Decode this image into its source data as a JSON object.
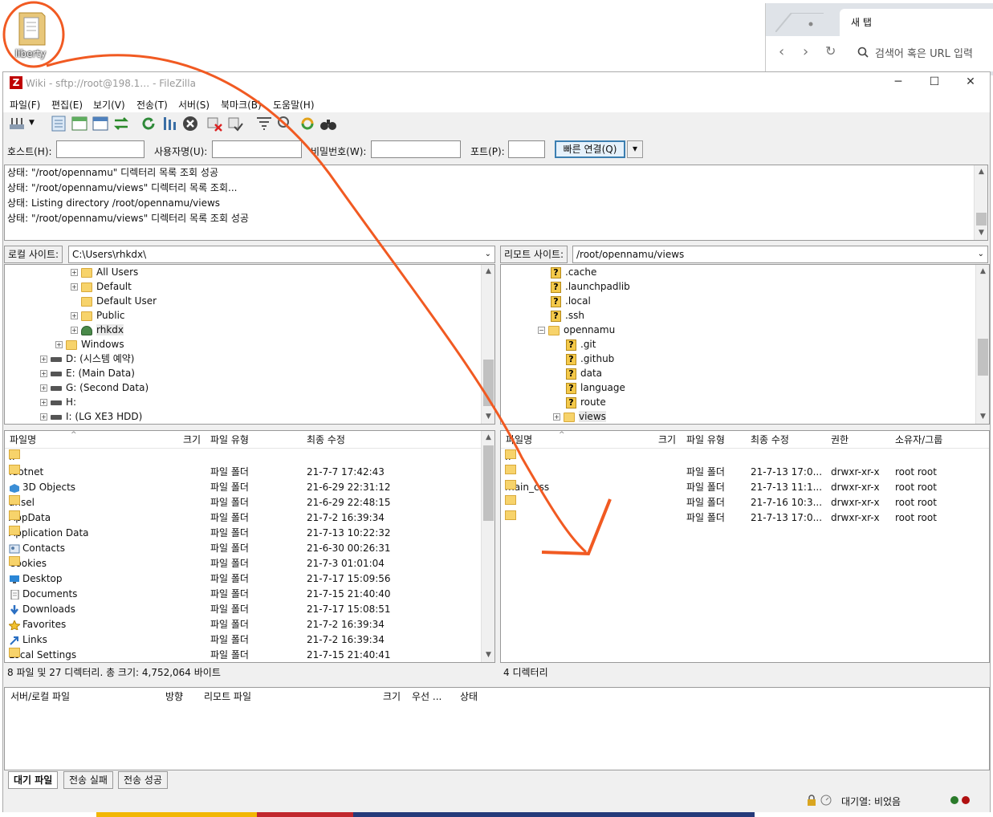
{
  "desktop": {
    "icon_label": "liberty"
  },
  "browser": {
    "tab_title": "새 탭",
    "url_placeholder": "검색어 혹은 URL 입력"
  },
  "window": {
    "title": "Wiki - sftp://root@198.1…          - FileZilla",
    "logo": "Z"
  },
  "menu": [
    "파일(F)",
    "편집(E)",
    "보기(V)",
    "전송(T)",
    "서버(S)",
    "북마크(B)",
    "도움말(H)"
  ],
  "quickconnect": {
    "host_label": "호스트(H):",
    "user_label": "사용자명(U):",
    "pass_label": "비밀번호(W):",
    "port_label": "포트(P):",
    "host_value": "",
    "user_value": "",
    "pass_value": "",
    "port_value": "",
    "connect_label": "빠른 연결(Q)",
    "dropdown": "▾"
  },
  "log": [
    "상태:  \"/root/opennamu\" 디렉터리 목록 조회 성공",
    "상태:  \"/root/opennamu/views\" 디렉터리 목록 조회...",
    "상태:  Listing directory /root/opennamu/views",
    "상태:  \"/root/opennamu/views\" 디렉터리 목록 조회 성공"
  ],
  "local": {
    "site_label": "로컬 사이트:",
    "path": "C:\\Users\\rhkdx\\",
    "tree": [
      {
        "label": "All Users"
      },
      {
        "label": "Default"
      },
      {
        "label": "Default User"
      },
      {
        "label": "Public"
      },
      {
        "label": "rhkdx"
      },
      {
        "label": "Windows"
      },
      {
        "label": "D: (시스템 예약)"
      },
      {
        "label": "E: (Main Data)"
      },
      {
        "label": "G: (Second Data)"
      },
      {
        "label": "H:"
      },
      {
        "label": "I: (LG XE3 HDD)"
      }
    ],
    "headers": {
      "name": "파일명",
      "size": "크기",
      "type": "파일 유형",
      "modified": "최종 수정"
    },
    "files": [
      {
        "name": "..",
        "type": "",
        "modified": ""
      },
      {
        "name": ".dotnet",
        "type": "파일 폴더",
        "modified": "21-7-7 17:42:43"
      },
      {
        "name": "3D Objects",
        "type": "파일 폴더",
        "modified": "21-6-29 22:31:12"
      },
      {
        "name": "ansel",
        "type": "파일 폴더",
        "modified": "21-6-29 22:48:15"
      },
      {
        "name": "AppData",
        "type": "파일 폴더",
        "modified": "21-7-2 16:39:34"
      },
      {
        "name": "Application Data",
        "type": "파일 폴더",
        "modified": "21-7-13 10:22:32"
      },
      {
        "name": "Contacts",
        "type": "파일 폴더",
        "modified": "21-6-30 00:26:31"
      },
      {
        "name": "Cookies",
        "type": "파일 폴더",
        "modified": "21-7-3 01:01:04"
      },
      {
        "name": "Desktop",
        "type": "파일 폴더",
        "modified": "21-7-17 15:09:56"
      },
      {
        "name": "Documents",
        "type": "파일 폴더",
        "modified": "21-7-15 21:40:40"
      },
      {
        "name": "Downloads",
        "type": "파일 폴더",
        "modified": "21-7-17 15:08:51"
      },
      {
        "name": "Favorites",
        "type": "파일 폴더",
        "modified": "21-7-2 16:39:34"
      },
      {
        "name": "Links",
        "type": "파일 폴더",
        "modified": "21-7-2 16:39:34"
      },
      {
        "name": "Local Settings",
        "type": "파일 폴더",
        "modified": "21-7-15 21:40:41"
      }
    ],
    "status": "8 파일 및 27 디렉터리. 총 크기: 4,752,064 바이트"
  },
  "remote": {
    "site_label": "리모트 사이트:",
    "path": "/root/opennamu/views",
    "tree": [
      {
        "label": ".cache"
      },
      {
        "label": ".launchpadlib"
      },
      {
        "label": ".local"
      },
      {
        "label": ".ssh"
      },
      {
        "label": "opennamu"
      },
      {
        "label": ".git"
      },
      {
        "label": ".github"
      },
      {
        "label": "data"
      },
      {
        "label": "language"
      },
      {
        "label": "route"
      },
      {
        "label": "views"
      }
    ],
    "headers": {
      "name": "파일명",
      "size": "크기",
      "type": "파일 유형",
      "modified": "최종 수정",
      "perm": "권한",
      "owner": "소유자/그룹"
    },
    "files": [
      {
        "name": "..",
        "type": "",
        "modified": "",
        "perm": "",
        "owner": ""
      },
      {
        "name": "",
        "type": "파일 폴더",
        "modified": "21-7-13 17:0...",
        "perm": "drwxr-xr-x",
        "owner": "root root"
      },
      {
        "name": "main_css",
        "type": "파일 폴더",
        "modified": "21-7-13 11:1...",
        "perm": "drwxr-xr-x",
        "owner": "root root"
      },
      {
        "name": "",
        "type": "파일 폴더",
        "modified": "21-7-16 10:3...",
        "perm": "drwxr-xr-x",
        "owner": "root root"
      },
      {
        "name": "",
        "type": "파일 폴더",
        "modified": "21-7-13 17:0...",
        "perm": "drwxr-xr-x",
        "owner": "root root"
      }
    ],
    "status": "4 디렉터리"
  },
  "queue": {
    "headers": {
      "server_local": "서버/로컬 파일",
      "direction": "방향",
      "remote": "리모트 파일",
      "size": "크기",
      "priority": "우선 ...",
      "status": "상태"
    },
    "tabs": [
      "대기 파일",
      "전송 실패",
      "전송 성공"
    ],
    "footer": "대기열: 비었음"
  },
  "colors": {
    "annotation": "#f15a22",
    "folder": "#f7d36b",
    "accent": "#3c7fb1"
  }
}
